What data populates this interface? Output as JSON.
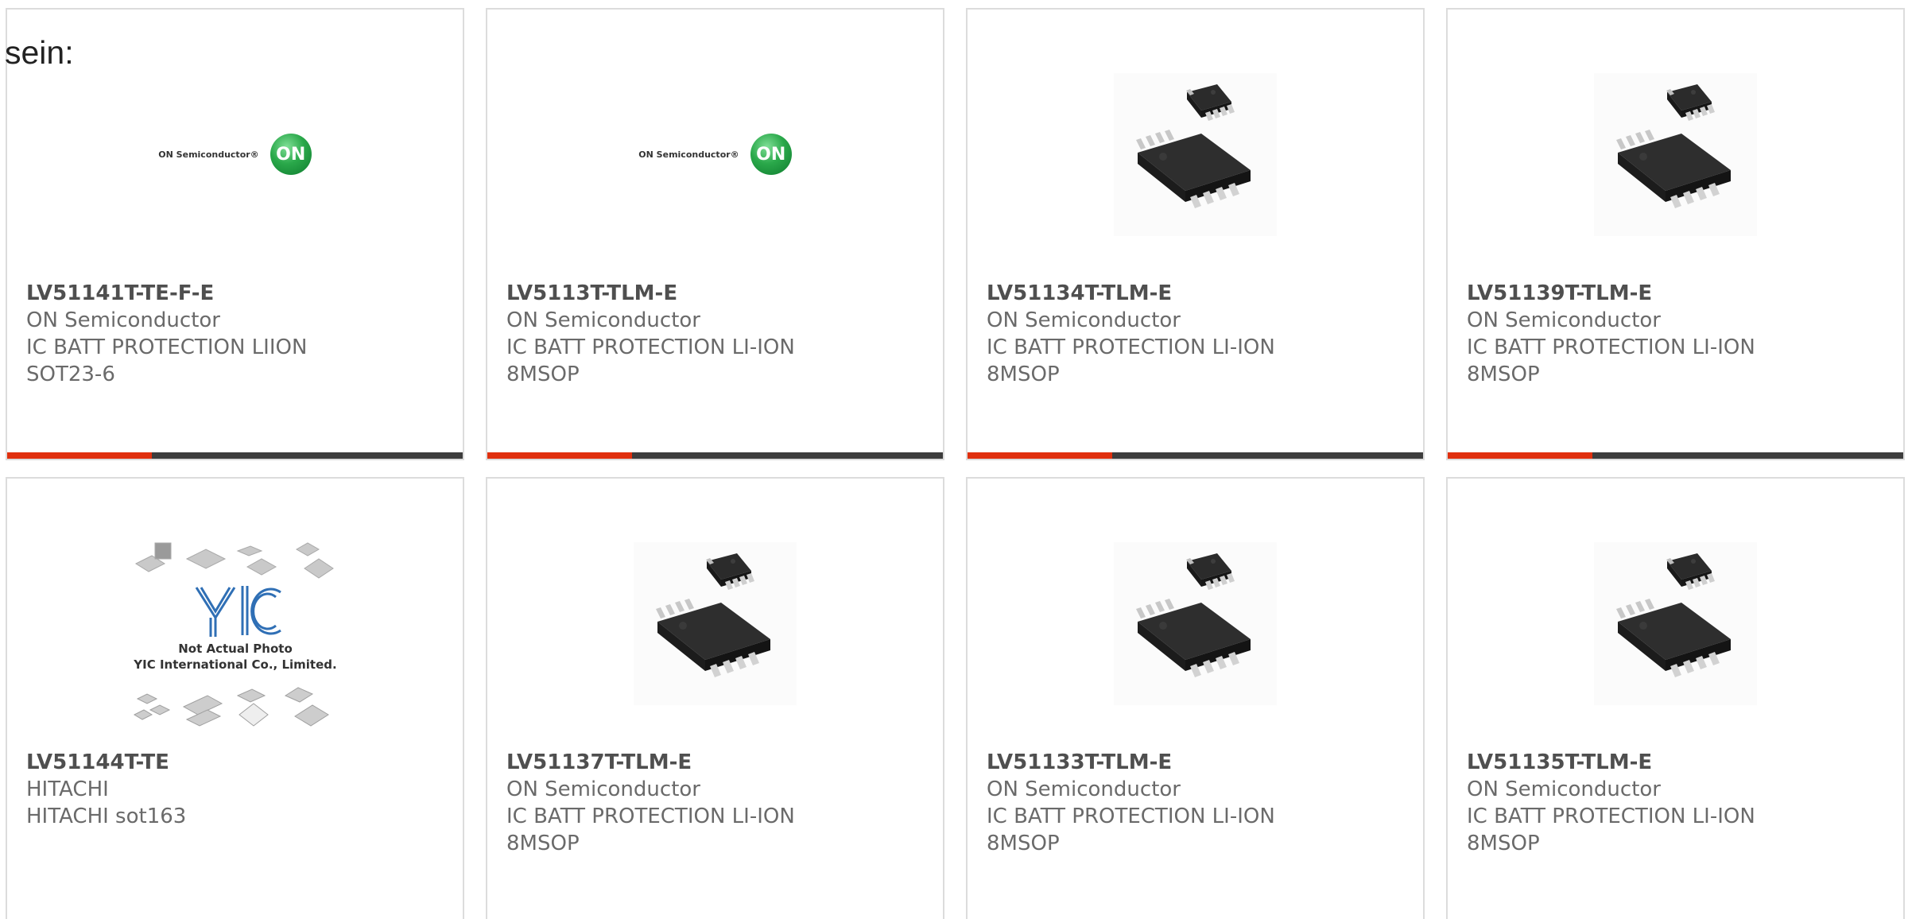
{
  "page": {
    "lead_text": "sein:"
  },
  "colors": {
    "accent_bar": "#e0300e",
    "bar_dark": "#3d3d3d",
    "card_border": "#dcdcdc"
  },
  "products": [
    {
      "part": "LV51141T-TE-F-E",
      "manufacturer": "ON Semiconductor",
      "description": "IC BATT PROTECTION LIION",
      "package": "SOT23-6",
      "image": "on-semiconductor-logo",
      "logo_text": "ON Semiconductor®",
      "logo_mark": "ON",
      "has_bar": true
    },
    {
      "part": "LV5113T-TLM-E",
      "manufacturer": "ON Semiconductor",
      "description": "IC BATT PROTECTION LI-ION",
      "package": "8MSOP",
      "image": "on-semiconductor-logo",
      "logo_text": "ON Semiconductor®",
      "logo_mark": "ON",
      "has_bar": true
    },
    {
      "part": "LV51134T-TLM-E",
      "manufacturer": "ON Semiconductor",
      "description": "IC BATT PROTECTION LI-ION",
      "package": "8MSOP",
      "image": "msop8-chip-photo",
      "has_bar": true
    },
    {
      "part": "LV51139T-TLM-E",
      "manufacturer": "ON Semiconductor",
      "description": "IC BATT PROTECTION LI-ION",
      "package": "8MSOP",
      "image": "msop8-chip-photo",
      "has_bar": true
    },
    {
      "part": "LV51144T-TE",
      "manufacturer": "HITACHI",
      "description": "HITACHI sot163",
      "package": "",
      "image": "yic-placeholder",
      "placeholder_line1": "Not Actual Photo",
      "placeholder_line2": "YIC International Co., Limited.",
      "has_bar": false
    },
    {
      "part": "LV51137T-TLM-E",
      "manufacturer": "ON Semiconductor",
      "description": "IC BATT PROTECTION LI-ION",
      "package": "8MSOP",
      "image": "msop8-chip-photo",
      "has_bar": false
    },
    {
      "part": "LV51133T-TLM-E",
      "manufacturer": "ON Semiconductor",
      "description": "IC BATT PROTECTION LI-ION",
      "package": "8MSOP",
      "image": "msop8-chip-photo",
      "has_bar": false
    },
    {
      "part": "LV51135T-TLM-E",
      "manufacturer": "ON Semiconductor",
      "description": "IC BATT PROTECTION LI-ION",
      "package": "8MSOP",
      "image": "msop8-chip-photo",
      "has_bar": false
    }
  ]
}
